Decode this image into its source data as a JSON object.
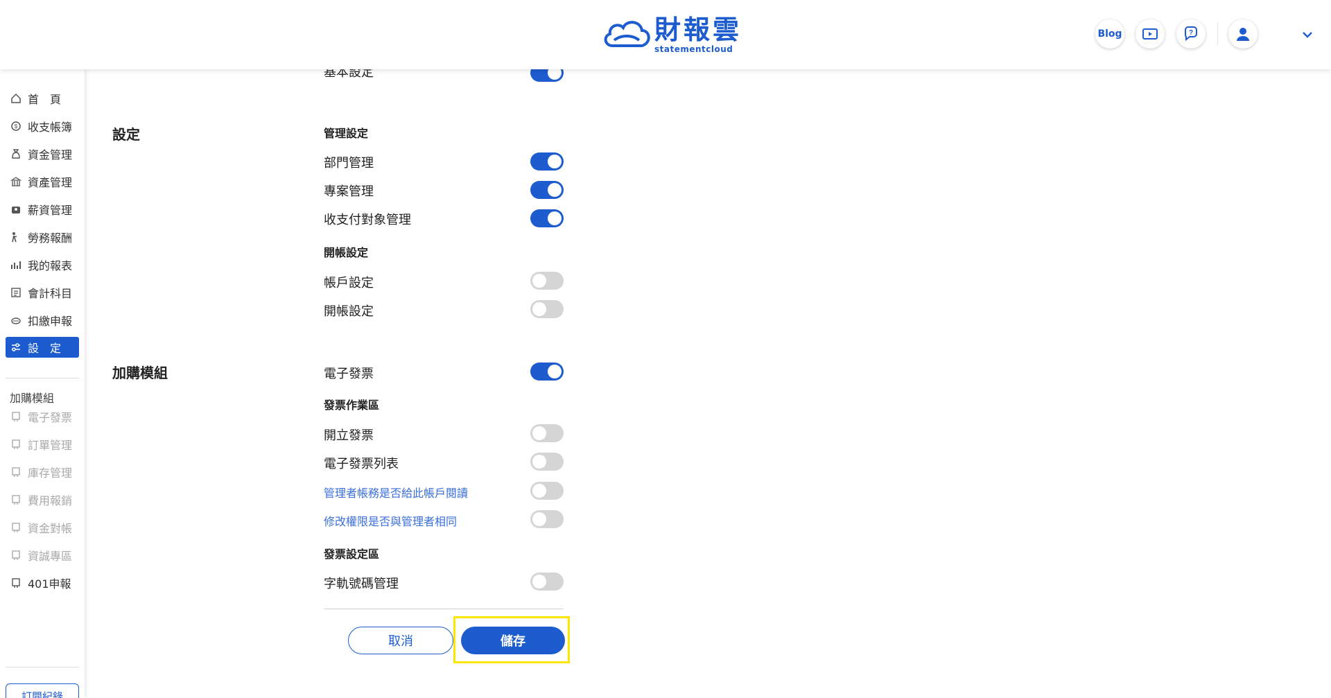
{
  "header": {
    "logo_cn": "財報雲",
    "logo_en": "statementcloud",
    "blog_label": "Blog"
  },
  "sidebar": {
    "items": [
      {
        "label": "首　頁",
        "icon": "home-icon"
      },
      {
        "label": "收支帳簿",
        "icon": "coin-icon"
      },
      {
        "label": "資金管理",
        "icon": "money-bag-icon"
      },
      {
        "label": "資產管理",
        "icon": "building-icon"
      },
      {
        "label": "薪資管理",
        "icon": "wallet-icon"
      },
      {
        "label": "勞務報酬",
        "icon": "worker-icon"
      },
      {
        "label": "我的報表",
        "icon": "chart-icon"
      },
      {
        "label": "會計科目",
        "icon": "ledger-icon"
      },
      {
        "label": "扣繳申報",
        "icon": "stamp-icon"
      },
      {
        "label": "設　定",
        "icon": "sliders-icon"
      }
    ],
    "addon_heading": "加購模組",
    "addons": [
      {
        "label": "電子發票"
      },
      {
        "label": "訂單管理"
      },
      {
        "label": "庫存管理"
      },
      {
        "label": "費用報銷"
      },
      {
        "label": "資金對帳"
      },
      {
        "label": "資誠專區"
      },
      {
        "label": "401申報"
      }
    ],
    "subscribe_label": "訂閱紀錄"
  },
  "main": {
    "partial_row_label": "基本設定",
    "settings_title": "設定",
    "mgmt_group": "管理設定",
    "mgmt_rows": [
      "部門管理",
      "專案管理",
      "收支付對象管理"
    ],
    "opening_group": "開帳設定",
    "opening_rows": [
      "帳戶設定",
      "開帳設定"
    ],
    "addon_title": "加購模組",
    "einvoice_label": "電子發票",
    "invoice_ops_group": "發票作業區",
    "invoice_ops_rows": [
      "開立發票",
      "電子發票列表"
    ],
    "invoice_ops_links": [
      "管理者帳務是否給此帳戶閱讀",
      "修改權限是否與管理者相同"
    ],
    "invoice_settings_group": "發票設定區",
    "invoice_settings_rows": [
      "字軌號碼管理"
    ],
    "cancel_label": "取消",
    "save_label": "儲存"
  },
  "toggle_states": {
    "basic": true,
    "department": true,
    "project": true,
    "counterparty": true,
    "account": false,
    "opening": false,
    "einvoice": true,
    "issue_invoice": false,
    "invoice_list": false,
    "manager_read": false,
    "same_permission": false,
    "track_number": false
  },
  "colors": {
    "accent": "#1d5ccf",
    "highlight": "#ffe600"
  }
}
